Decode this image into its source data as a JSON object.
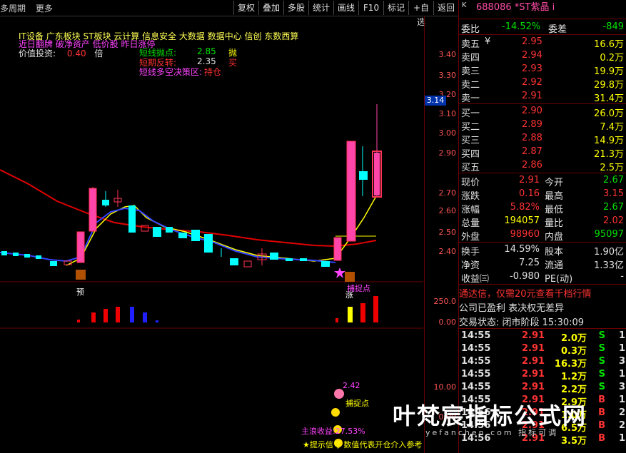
{
  "toolbar": {
    "left": [
      "多周期",
      "更多"
    ],
    "buttons": [
      "复权",
      "叠加",
      "多股",
      "统计",
      "画线",
      "F10",
      "标记",
      "+自选",
      "返回"
    ]
  },
  "indicators": {
    "line1": "IT设备 广东板块 ST板块 云计算 信息安全 大数据 数据中心 信创 东数西算",
    "line2": "近日翻牌 破净资产 低价股 昨日涨停",
    "value_label": "价值投资:",
    "value_num": "0.40",
    "value_unit": "倍",
    "short_sell_label": "短线抛点:",
    "short_sell_val": "2.85",
    "short_sell_act": "抛",
    "short_rev_label": "短期反转:",
    "short_rev_val": "2.35",
    "short_rev_act": "买",
    "short_dec_label": "短线多空决策区:",
    "short_dec_act": "持仓",
    "yu": "预",
    "zhang": "涨",
    "catch1": "捕捉点",
    "catch2": "捕捉点",
    "low_val": "2.42",
    "main_label": "主浪收益:",
    "main_val": "27.53%",
    "hint": "★提示信号 数值代表开仓介入参考"
  },
  "yaxis": {
    "price": [
      "3.40",
      "3.30",
      "3.20",
      "3.10",
      "3.00",
      "2.90",
      "2.80",
      "2.70",
      "2.60",
      "2.50",
      "2.40"
    ],
    "current": "3.14",
    "vol": [
      "250.0",
      "0.00"
    ],
    "sub": [
      "10.00",
      "0.00"
    ]
  },
  "quote": {
    "code_name": "688086 *ST紫晶 i",
    "k_icon": "K",
    "weibi_label": "委比",
    "weibi_val": "-14.52%",
    "weicha_label": "委差",
    "weicha_val": "-849",
    "asks": [
      {
        "label": "卖五",
        "flag": "¥",
        "price": "2.95",
        "vol": "16.6万"
      },
      {
        "label": "卖四",
        "flag": "",
        "price": "2.94",
        "vol": "0.2万"
      },
      {
        "label": "卖三",
        "flag": "",
        "price": "2.93",
        "vol": "19.9万"
      },
      {
        "label": "卖二",
        "flag": "",
        "price": "2.92",
        "vol": "29.8万"
      },
      {
        "label": "卖一",
        "flag": "",
        "price": "2.91",
        "vol": "31.4万"
      }
    ],
    "bids": [
      {
        "label": "买一",
        "price": "2.90",
        "vol": "26.0万"
      },
      {
        "label": "买二",
        "price": "2.89",
        "vol": "7.4万"
      },
      {
        "label": "买三",
        "price": "2.88",
        "vol": "14.9万"
      },
      {
        "label": "买四",
        "price": "2.87",
        "vol": "21.3万"
      },
      {
        "label": "买五",
        "price": "2.86",
        "vol": "2.5万"
      }
    ],
    "stats": [
      {
        "l1": "现价",
        "v1": "2.91",
        "c1": "red",
        "l2": "今开",
        "v2": "2.67",
        "c2": "green"
      },
      {
        "l1": "涨跌",
        "v1": "0.16",
        "c1": "red",
        "l2": "最高",
        "v2": "3.15",
        "c2": "red"
      },
      {
        "l1": "涨幅",
        "v1": "5.82%",
        "c1": "red",
        "l2": "最低",
        "v2": "2.67",
        "c2": "green"
      },
      {
        "l1": "总量",
        "v1": "194057",
        "c1": "yellow",
        "l2": "量比",
        "v2": "2.02",
        "c2": "red"
      },
      {
        "l1": "外盘",
        "v1": "98960",
        "c1": "red",
        "l2": "内盘",
        "v2": "95097",
        "c2": "green"
      }
    ],
    "stats2": [
      {
        "l1": "换手",
        "v1": "14.59%",
        "l2": "股本",
        "v2": "1.90亿"
      },
      {
        "l1": "净资",
        "v1": "7.25",
        "l2": "流通",
        "v2": "1.33亿"
      },
      {
        "l1": "收益㈢",
        "v1": "-0.980",
        "l2": "PE(动)",
        "v2": "-"
      }
    ],
    "ad": "通达信，仅需20元查看千档行情",
    "profit": "公司已盈利 表决权无差异",
    "status": "交易状态: 闭市阶段 15:30:09",
    "ticks": [
      {
        "t": "14:55",
        "p": "2.91",
        "v": "2.0万",
        "s": "S",
        "n": "1"
      },
      {
        "t": "14:55",
        "p": "2.91",
        "v": "0.3万",
        "s": "S",
        "n": "1"
      },
      {
        "t": "14:55",
        "p": "2.91",
        "v": "16.3万",
        "s": "S",
        "n": "3"
      },
      {
        "t": "14:55",
        "p": "2.91",
        "v": "1.2万",
        "s": "S",
        "n": "1"
      },
      {
        "t": "14:55",
        "p": "2.91",
        "v": "2.2万",
        "s": "S",
        "n": "3"
      },
      {
        "t": "14:55",
        "p": "2.91",
        "v": "2.9万",
        "s": "B",
        "n": "1"
      },
      {
        "t": "14:56",
        "p": "2.91",
        "v": "1.0万",
        "s": "B",
        "n": "2"
      },
      {
        "t": "14:56",
        "p": "2.91",
        "v": "6.5万",
        "s": "B",
        "n": "2"
      },
      {
        "t": "14:56",
        "p": "2.91",
        "v": "3.5万",
        "s": "B",
        "n": "1"
      }
    ]
  },
  "watermark": {
    "main": "叶梵宸指标公式网",
    "sub": "yefanchen.com 指标可调"
  }
}
